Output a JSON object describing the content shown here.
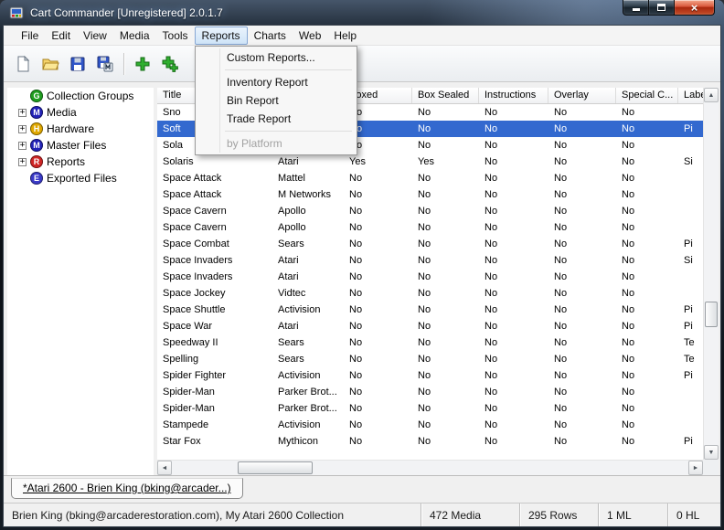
{
  "window": {
    "title": "Cart Commander [Unregistered] 2.0.1.7"
  },
  "menubar": {
    "items": [
      {
        "label": "File"
      },
      {
        "label": "Edit"
      },
      {
        "label": "View"
      },
      {
        "label": "Media"
      },
      {
        "label": "Tools"
      },
      {
        "label": "Reports",
        "active": true
      },
      {
        "label": "Charts"
      },
      {
        "label": "Web"
      },
      {
        "label": "Help"
      }
    ]
  },
  "dropdown": {
    "items": [
      {
        "label": "Custom Reports..."
      },
      {
        "type": "separator"
      },
      {
        "label": "Inventory Report"
      },
      {
        "label": "Bin Report"
      },
      {
        "label": "Trade Report"
      },
      {
        "type": "separator"
      },
      {
        "label": "by Platform",
        "disabled": true
      }
    ]
  },
  "toolbar": {
    "buttons": [
      "new-document",
      "open",
      "save",
      "save-as",
      "add-media",
      "add-media-batch"
    ]
  },
  "tree": {
    "items": [
      {
        "label": "Collection Groups",
        "icon_letter": "G",
        "icon_color": "#1f9e1f",
        "expander": false
      },
      {
        "label": "Media",
        "icon_letter": "M",
        "icon_color": "#2222b8",
        "expander": true
      },
      {
        "label": "Hardware",
        "icon_letter": "H",
        "icon_color": "#e0a800",
        "expander": true
      },
      {
        "label": "Master Files",
        "icon_letter": "M",
        "icon_color": "#2222b8",
        "expander": true
      },
      {
        "label": "Reports",
        "icon_letter": "R",
        "icon_color": "#cf2525",
        "expander": true
      },
      {
        "label": "Exported Files",
        "icon_letter": "E",
        "icon_color": "#3a3ac8",
        "expander": false
      }
    ]
  },
  "table": {
    "columns": [
      {
        "key": "title",
        "label": "Title",
        "width": 126
      },
      {
        "key": "manufacturer",
        "label": "",
        "width": 78
      },
      {
        "key": "boxed",
        "label": "Boxed",
        "width": 75
      },
      {
        "key": "box_sealed",
        "label": "Box Sealed",
        "width": 73
      },
      {
        "key": "instructions",
        "label": "Instructions",
        "width": 76
      },
      {
        "key": "overlay",
        "label": "Overlay",
        "width": 74
      },
      {
        "key": "special",
        "label": "Special C...",
        "width": 68
      },
      {
        "key": "label_type",
        "label": "Label",
        "width": 55
      }
    ],
    "rows": [
      {
        "cells": [
          "Sno",
          "",
          "No",
          "No",
          "No",
          "No",
          "No",
          ""
        ],
        "selected": false
      },
      {
        "cells": [
          "Soft",
          "",
          "No",
          "No",
          "No",
          "No",
          "No",
          "Pi"
        ],
        "selected": true
      },
      {
        "cells": [
          "Sola",
          "",
          "No",
          "No",
          "No",
          "No",
          "No",
          ""
        ],
        "selected": false
      },
      {
        "cells": [
          "Solaris",
          "Atari",
          "Yes",
          "Yes",
          "No",
          "No",
          "No",
          "Si"
        ],
        "selected": false
      },
      {
        "cells": [
          "Space Attack",
          "Mattel",
          "No",
          "No",
          "No",
          "No",
          "No",
          ""
        ],
        "selected": false
      },
      {
        "cells": [
          "Space Attack",
          "M Networks",
          "No",
          "No",
          "No",
          "No",
          "No",
          ""
        ],
        "selected": false
      },
      {
        "cells": [
          "Space Cavern",
          "Apollo",
          "No",
          "No",
          "No",
          "No",
          "No",
          ""
        ],
        "selected": false
      },
      {
        "cells": [
          "Space Cavern",
          "Apollo",
          "No",
          "No",
          "No",
          "No",
          "No",
          ""
        ],
        "selected": false
      },
      {
        "cells": [
          "Space Combat",
          "Sears",
          "No",
          "No",
          "No",
          "No",
          "No",
          "Pi"
        ],
        "selected": false
      },
      {
        "cells": [
          "Space Invaders",
          "Atari",
          "No",
          "No",
          "No",
          "No",
          "No",
          "Si"
        ],
        "selected": false
      },
      {
        "cells": [
          "Space Invaders",
          "Atari",
          "No",
          "No",
          "No",
          "No",
          "No",
          ""
        ],
        "selected": false
      },
      {
        "cells": [
          "Space Jockey",
          "Vidtec",
          "No",
          "No",
          "No",
          "No",
          "No",
          ""
        ],
        "selected": false
      },
      {
        "cells": [
          "Space Shuttle",
          "Activision",
          "No",
          "No",
          "No",
          "No",
          "No",
          "Pi"
        ],
        "selected": false
      },
      {
        "cells": [
          "Space War",
          "Atari",
          "No",
          "No",
          "No",
          "No",
          "No",
          "Pi"
        ],
        "selected": false
      },
      {
        "cells": [
          "Speedway II",
          "Sears",
          "No",
          "No",
          "No",
          "No",
          "No",
          "Te"
        ],
        "selected": false
      },
      {
        "cells": [
          "Spelling",
          "Sears",
          "No",
          "No",
          "No",
          "No",
          "No",
          "Te"
        ],
        "selected": false
      },
      {
        "cells": [
          "Spider Fighter",
          "Activision",
          "No",
          "No",
          "No",
          "No",
          "No",
          "Pi"
        ],
        "selected": false
      },
      {
        "cells": [
          "Spider-Man",
          "Parker Brot...",
          "No",
          "No",
          "No",
          "No",
          "No",
          ""
        ],
        "selected": false
      },
      {
        "cells": [
          "Spider-Man",
          "Parker Brot...",
          "No",
          "No",
          "No",
          "No",
          "No",
          ""
        ],
        "selected": false
      },
      {
        "cells": [
          "Stampede",
          "Activision",
          "No",
          "No",
          "No",
          "No",
          "No",
          ""
        ],
        "selected": false
      },
      {
        "cells": [
          "Star Fox",
          "Mythicon",
          "No",
          "No",
          "No",
          "No",
          "No",
          "Pi"
        ],
        "selected": false
      }
    ]
  },
  "bottom_tab": {
    "label": "*Atari 2600 - Brien King (bking@arcader...)"
  },
  "statusbar": {
    "panels": [
      {
        "text": "Brien King (bking@arcaderestoration.com), My Atari 2600 Collection"
      },
      {
        "text": "472 Media",
        "width": 108
      },
      {
        "text": "295 Rows",
        "width": 86
      },
      {
        "text": "1 ML",
        "width": 76
      },
      {
        "text": "0 HL",
        "width": 58
      }
    ]
  }
}
